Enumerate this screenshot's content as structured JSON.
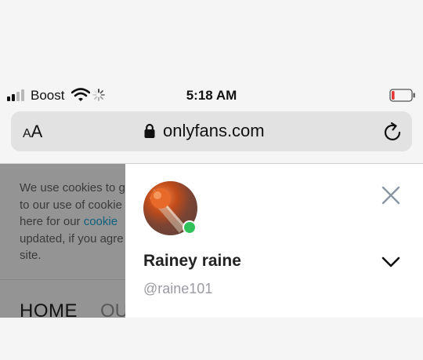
{
  "status_bar": {
    "carrier": "Boost",
    "time": "5:18 AM",
    "signal_bars_total": 4,
    "signal_bars_active": 2,
    "battery_level": 0.15,
    "battery_color": "#e53935"
  },
  "url_bar": {
    "text_size_label_small": "A",
    "text_size_label_big": "A",
    "url": "onlyfans.com",
    "icons": [
      "lock-icon",
      "reload-icon"
    ]
  },
  "page": {
    "cookie_lines": [
      "We use cookies to g",
      "to our use of cookie",
      "here for our ",
      "updated, if you agre",
      "site."
    ],
    "cookie_link_text": "cookie",
    "nav_home": "HOME",
    "nav_next": "OU"
  },
  "drawer": {
    "name": "Rainey raine",
    "handle": "@raine101",
    "online_color": "#30c15a",
    "icons": [
      "close-icon",
      "chevron-down-icon"
    ]
  }
}
